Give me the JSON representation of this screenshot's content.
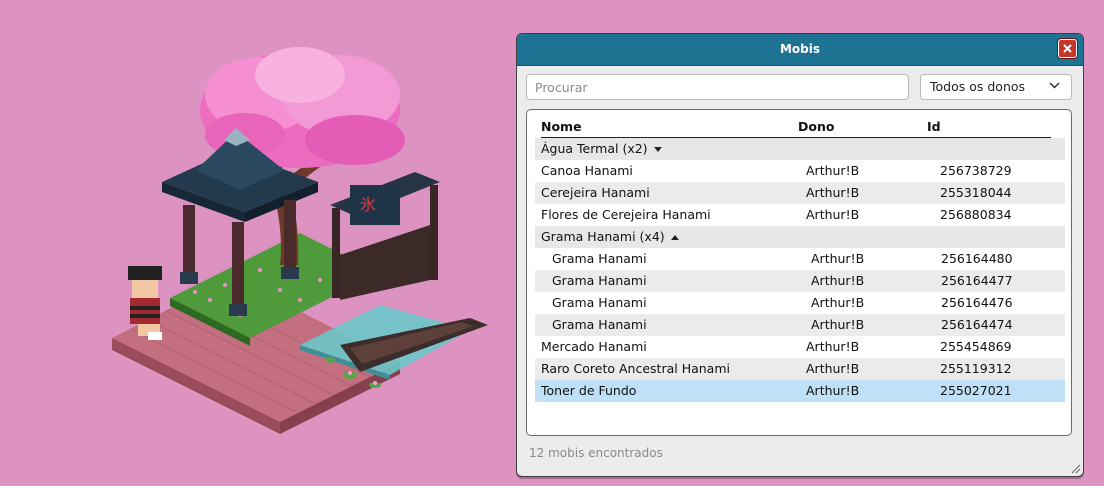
{
  "window": {
    "title": "Mobis",
    "close_icon": "close-icon",
    "search_placeholder": "Procurar",
    "owner_filter": "Todos os donos",
    "columns": {
      "name": "Nome",
      "owner": "Dono",
      "id": "Id"
    },
    "groups": [
      {
        "label": "Água Termal (x2)",
        "expanded": false
      },
      {
        "label": "Grama Hanami (x4)",
        "expanded": true
      }
    ],
    "items": [
      {
        "name": "Canoa Hanami",
        "owner": "Arthur!B",
        "id": "256738729"
      },
      {
        "name": "Cerejeira Hanami",
        "owner": "Arthur!B",
        "id": "255318044"
      },
      {
        "name": "Flores de Cerejeira Hanami",
        "owner": "Arthur!B",
        "id": "256880834"
      },
      {
        "name": "Grama Hanami",
        "owner": "Arthur!B",
        "id": "256164480"
      },
      {
        "name": "Grama Hanami",
        "owner": "Arthur!B",
        "id": "256164477"
      },
      {
        "name": "Grama Hanami",
        "owner": "Arthur!B",
        "id": "256164476"
      },
      {
        "name": "Grama Hanami",
        "owner": "Arthur!B",
        "id": "256164474"
      },
      {
        "name": "Mercado Hanami",
        "owner": "Arthur!B",
        "id": "255454869"
      },
      {
        "name": "Raro Coreto Ancestral Hanami",
        "owner": "Arthur!B",
        "id": "255119312"
      },
      {
        "name": "Toner de Fundo",
        "owner": "Arthur!B",
        "id": "255027021"
      }
    ],
    "status": "12 mobis encontrados"
  },
  "colors": {
    "background": "#dc93c1",
    "titlebar": "#1e7292",
    "selected_row": "#bfe1f8",
    "close_button": "#c6352c"
  }
}
